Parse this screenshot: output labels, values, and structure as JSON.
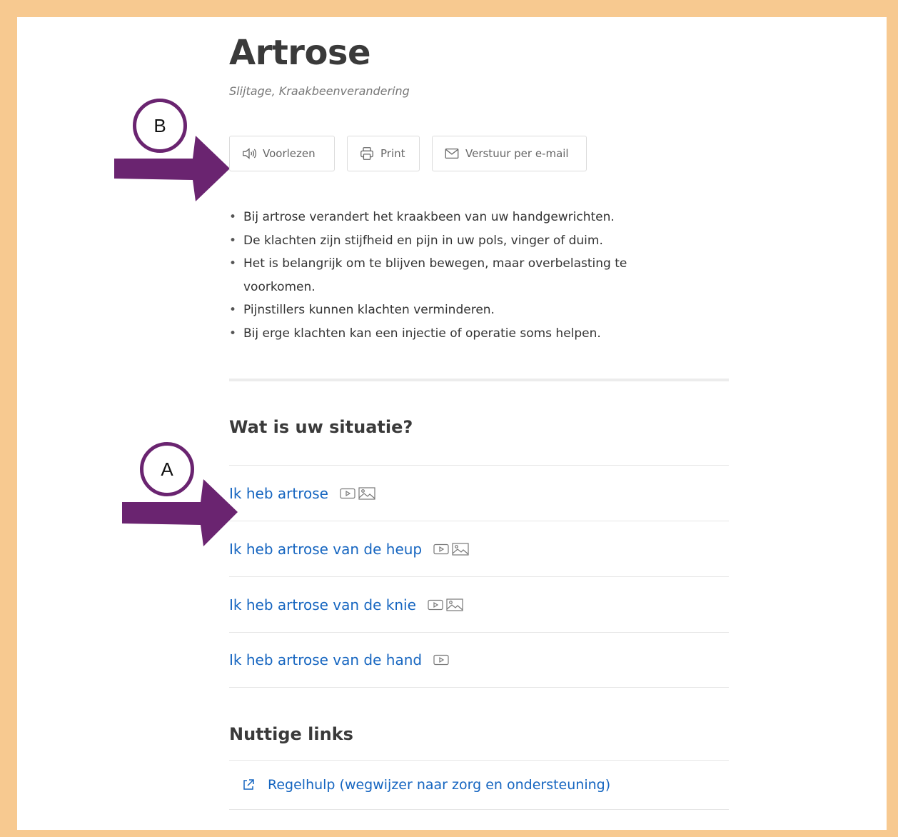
{
  "article": {
    "title": "Artrose",
    "subtitle": "Slijtage, Kraakbeenverandering"
  },
  "actions": {
    "read_aloud": "Voorlezen",
    "print": "Print",
    "email": "Verstuur per e-mail"
  },
  "summary": [
    "Bij artrose verandert het kraakbeen van uw handgewrichten.",
    "De klachten zijn stijfheid en pijn in uw pols, vinger of duim.",
    "Het is belangrijk om te blijven bewegen, maar overbelasting te voorkomen.",
    "Pijnstillers kunnen klachten verminderen.",
    "Bij erge klachten kan een injectie of operatie soms helpen."
  ],
  "situation": {
    "heading": "Wat is uw situatie?",
    "items": [
      {
        "label": "Ik heb artrose",
        "icons": [
          "video-icon",
          "image-icon"
        ]
      },
      {
        "label": "Ik heb artrose van de heup",
        "icons": [
          "video-icon",
          "image-icon"
        ]
      },
      {
        "label": "Ik heb artrose van de knie",
        "icons": [
          "video-icon",
          "image-icon"
        ]
      },
      {
        "label": "Ik heb artrose van de hand",
        "icons": [
          "video-icon"
        ]
      }
    ]
  },
  "useful_links": {
    "heading": "Nuttige links",
    "items": [
      {
        "label": "Regelhulp (wegwijzer naar zorg en ondersteuning)",
        "icon": "external-link-icon"
      }
    ]
  },
  "annotations": {
    "marker_a": "A",
    "marker_b": "B",
    "color": "#6a2470"
  },
  "colors": {
    "frame": "#f7c990",
    "link": "#1565c0"
  }
}
